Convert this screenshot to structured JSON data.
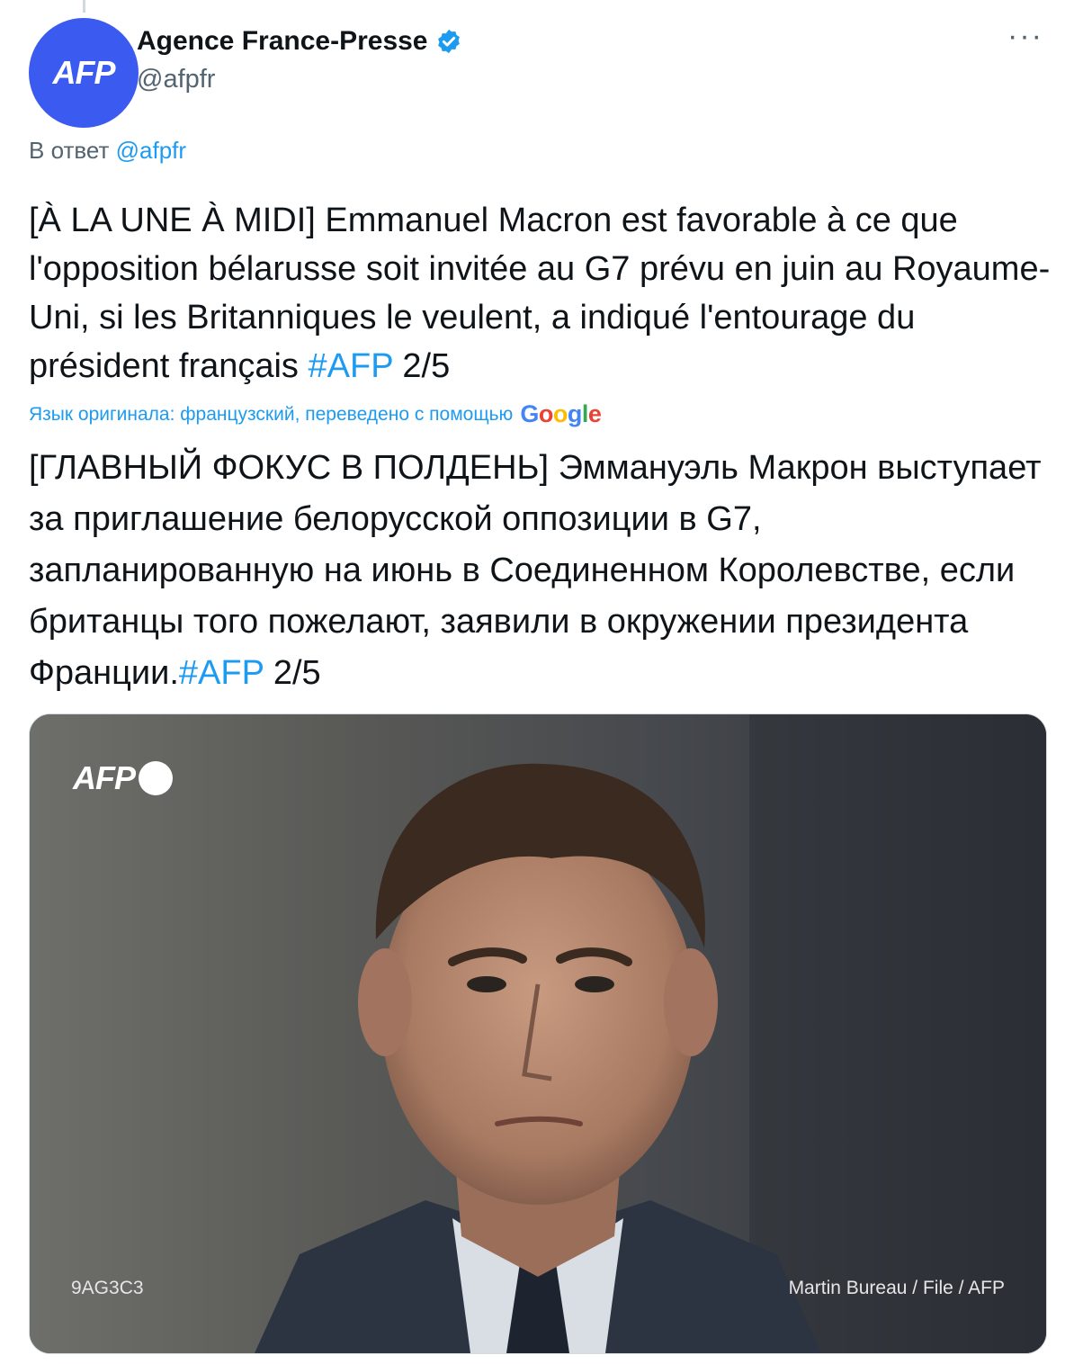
{
  "author": {
    "avatar_text": "AFP",
    "name": "Agence France-Presse",
    "handle": "@afpfr",
    "verified": true
  },
  "menu": {
    "more_label": "···"
  },
  "reply": {
    "prefix": "В ответ",
    "mention": "@afpfr"
  },
  "tweet": {
    "text": "[À LA UNE À MIDI] Emmanuel Macron est favorable à ce que l'opposition bélarusse soit invitée au G7 prévu en juin au Royaume-Uni, si les Britanniques le veulent, a indiqué l'entourage du président français ",
    "hashtag": "#AFP",
    "suffix": " 2/5"
  },
  "translation": {
    "meta_label": "Язык оригинала: французский, переведено с помощью",
    "provider": "Google",
    "text": "[ГЛАВНЫЙ ФОКУС В ПОЛДЕНЬ] Эммануэль Макрон выступает за приглашение белорусской оппозиции в G7, запланированную на июнь в Соединенном Королевстве, если британцы того пожелают, заявили в окружении президента Франции.",
    "hashtag": "#AFP",
    "suffix": " 2/5"
  },
  "media": {
    "watermark": "AFP",
    "photo_id": "9AG3C3",
    "credit": "Martin Bureau / File / AFP"
  },
  "colors": {
    "accent": "#1d9bf0",
    "avatar_bg": "#3b5bf0",
    "secondary_text": "#536471"
  }
}
